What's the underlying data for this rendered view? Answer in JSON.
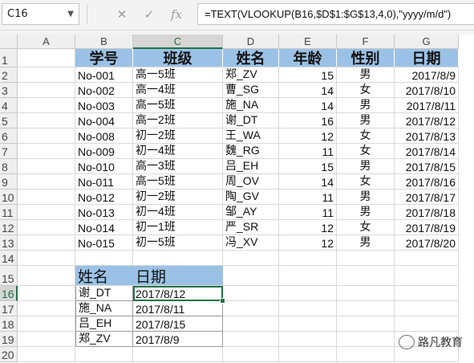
{
  "formula_bar": {
    "name_box": "C16",
    "name_box_dropdown_icon": "chevron-down-icon",
    "cancel_icon": "close-icon",
    "enter_icon": "check-icon",
    "fx_icon": "function-icon",
    "fx_label": "fx",
    "formula": "=TEXT(VLOOKUP(B16,$D$1:$G$13,4,0),\"yyyy/m/d\")"
  },
  "columns": [
    "A",
    "B",
    "C",
    "D",
    "E",
    "F",
    "G"
  ],
  "selected_column": "C",
  "rows": [
    "1",
    "2",
    "3",
    "4",
    "5",
    "6",
    "7",
    "8",
    "9",
    "10",
    "11",
    "12",
    "13",
    "14",
    "15",
    "16",
    "17",
    "18",
    "19",
    "20"
  ],
  "selected_row": "16",
  "main_table": {
    "headers": [
      "学号",
      "班级",
      "姓名",
      "年龄",
      "性别",
      "日期"
    ],
    "rows": [
      [
        "No-001",
        "高一5班",
        "郑_ZV",
        "15",
        "男",
        "2017/8/9"
      ],
      [
        "No-002",
        "高一4班",
        "曹_SG",
        "14",
        "女",
        "2017/8/10"
      ],
      [
        "No-003",
        "高一5班",
        "施_NA",
        "14",
        "男",
        "2017/8/11"
      ],
      [
        "No-004",
        "高一2班",
        "谢_DT",
        "16",
        "男",
        "2017/8/12"
      ],
      [
        "No-008",
        "初一2班",
        "王_WA",
        "12",
        "女",
        "2017/8/13"
      ],
      [
        "No-009",
        "初一4班",
        "魏_RG",
        "11",
        "女",
        "2017/8/14"
      ],
      [
        "No-010",
        "高一3班",
        "吕_EH",
        "15",
        "男",
        "2017/8/15"
      ],
      [
        "No-011",
        "高一5班",
        "周_OV",
        "14",
        "女",
        "2017/8/16"
      ],
      [
        "No-012",
        "初一2班",
        "陶_GV",
        "11",
        "男",
        "2017/8/17"
      ],
      [
        "No-013",
        "初一4班",
        "邹_AY",
        "11",
        "男",
        "2017/8/18"
      ],
      [
        "No-014",
        "初一1班",
        "严_SR",
        "12",
        "女",
        "2017/8/19"
      ],
      [
        "No-015",
        "初一5班",
        "冯_XV",
        "12",
        "男",
        "2017/8/20"
      ]
    ]
  },
  "lookup_table": {
    "headers": [
      "姓名",
      "日期"
    ],
    "rows": [
      [
        "谢_DT",
        "2017/8/12"
      ],
      [
        "施_NA",
        "2017/8/11"
      ],
      [
        "吕_EH",
        "2017/8/15"
      ],
      [
        "郑_ZV",
        "2017/8/9"
      ]
    ]
  },
  "watermark": {
    "icon": "wechat-icon",
    "text": "路凡教育"
  },
  "colors": {
    "header_fill": "#9bc2e6",
    "selection": "#217346"
  }
}
